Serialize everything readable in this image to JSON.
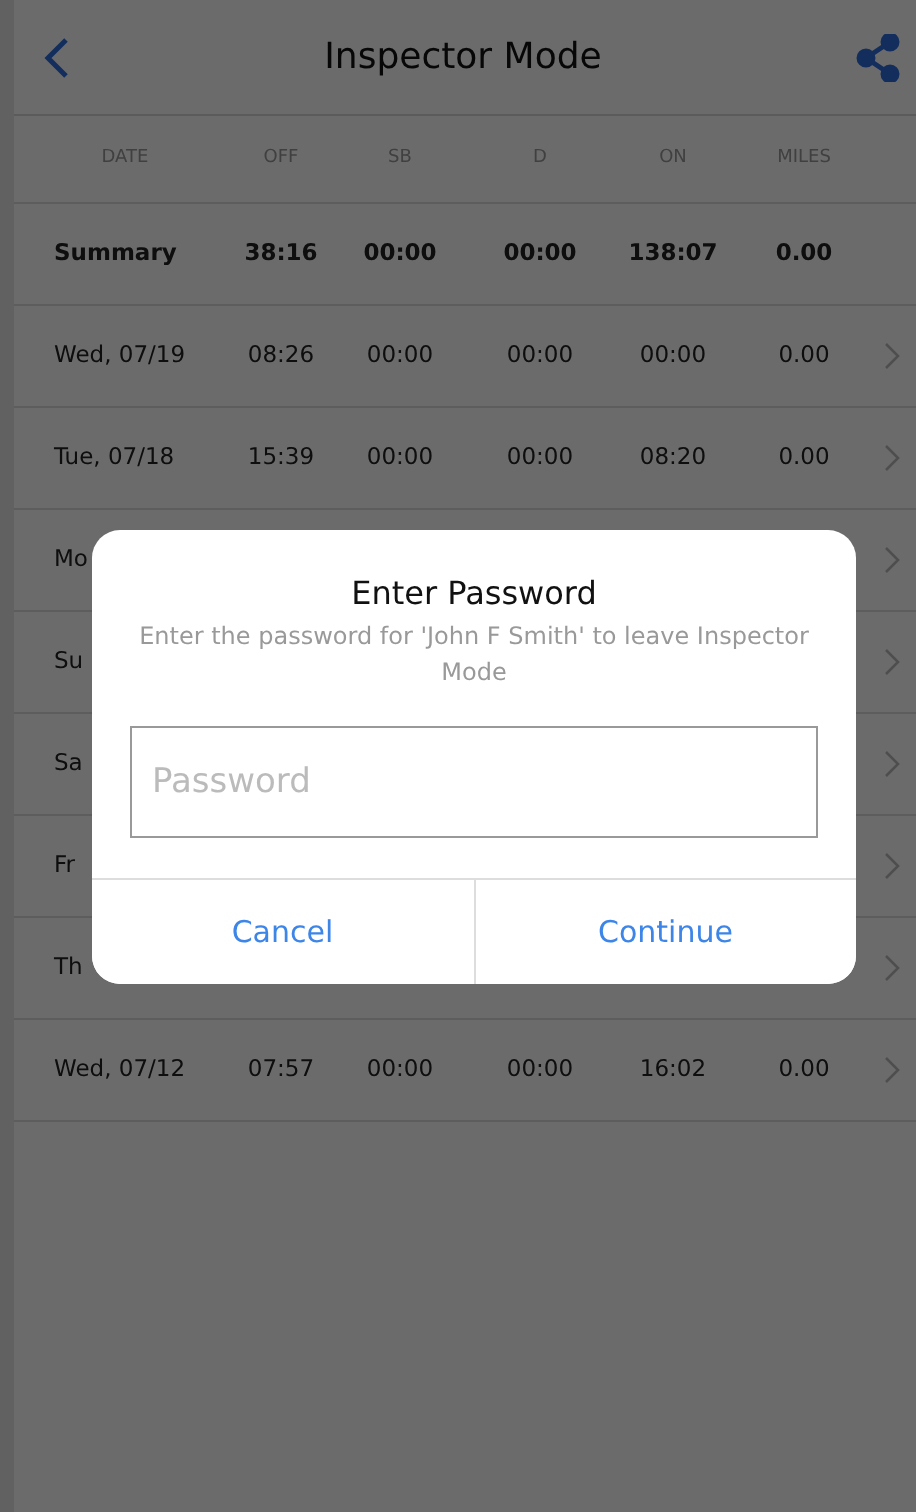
{
  "header": {
    "title": "Inspector Mode"
  },
  "columns": [
    "DATE",
    "OFF",
    "SB",
    "D",
    "ON",
    "MILES"
  ],
  "rows": [
    {
      "kind": "summary",
      "cells": [
        "Summary",
        "38:16",
        "00:00",
        "00:00",
        "138:07",
        "0.00"
      ]
    },
    {
      "kind": "day",
      "cells": [
        "Wed, 07/19",
        "08:26",
        "00:00",
        "00:00",
        "00:00",
        "0.00"
      ]
    },
    {
      "kind": "day",
      "cells": [
        "Tue, 07/18",
        "15:39",
        "00:00",
        "00:00",
        "08:20",
        "0.00"
      ]
    },
    {
      "kind": "day",
      "cells": [
        "Mo"
      ]
    },
    {
      "kind": "day",
      "cells": [
        "Su"
      ]
    },
    {
      "kind": "day",
      "cells": [
        "Sa"
      ]
    },
    {
      "kind": "day",
      "cells": [
        "Fr"
      ]
    },
    {
      "kind": "day",
      "cells": [
        "Th"
      ]
    },
    {
      "kind": "day",
      "cells": [
        "Wed, 07/12",
        "07:57",
        "00:00",
        "00:00",
        "16:02",
        "0.00"
      ]
    }
  ],
  "dialog": {
    "title": "Enter Password",
    "message": "Enter the password for 'John F Smith' to leave Inspector Mode",
    "field": {
      "placeholder": "Password"
    },
    "buttons": [
      "Cancel",
      "Continue"
    ]
  }
}
